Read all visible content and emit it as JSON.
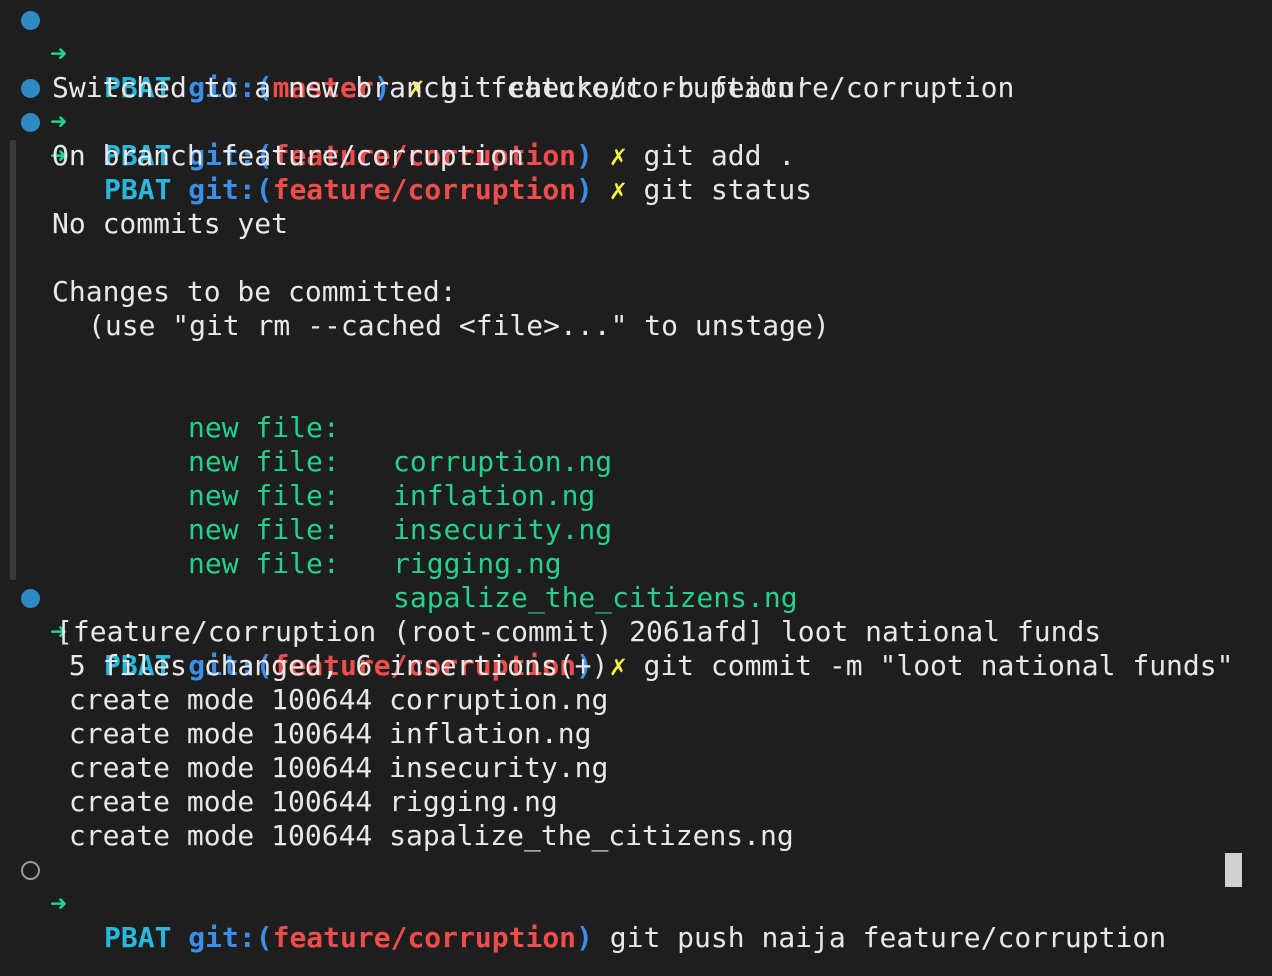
{
  "prompts": [
    {
      "dir": "PBAT",
      "git_prefix": "git:(",
      "branch": "master",
      "git_suffix": ")",
      "dirty": "✗",
      "command": "git checkout -b feature/corruption"
    },
    {
      "dir": "PBAT",
      "git_prefix": "git:(",
      "branch": "feature/corruption",
      "git_suffix": ")",
      "dirty": "✗",
      "command": "git add ."
    },
    {
      "dir": "PBAT",
      "git_prefix": "git:(",
      "branch": "feature/corruption",
      "git_suffix": ")",
      "dirty": "✗",
      "command": "git status"
    },
    {
      "dir": "PBAT",
      "git_prefix": "git:(",
      "branch": "feature/corruption",
      "git_suffix": ")",
      "dirty": "✗",
      "command": "git commit -m \"loot national funds\""
    },
    {
      "dir": "PBAT",
      "git_prefix": "git:(",
      "branch": "feature/corruption",
      "git_suffix": ")",
      "dirty": "",
      "command": "git push naija feature/corruption"
    }
  ],
  "arrow": "➜",
  "checkout_output": "Switched to a new branch 'feature/corruption'",
  "status_output": {
    "on_branch": "On branch feature/corruption",
    "no_commits": "No commits yet",
    "changes_header": "Changes to be committed:",
    "hint": "(use \"git rm --cached <file>...\" to unstage)",
    "new_file_label": "new file:",
    "files": [
      "corruption.ng",
      "inflation.ng",
      "insecurity.ng",
      "rigging.ng",
      "sapalize_the_citizens.ng"
    ]
  },
  "commit_output": {
    "summary": "[feature/corruption (root-commit) 2061afd] loot national funds",
    "stats": " 5 files changed, 6 insertions(+)",
    "create_lines": [
      " create mode 100644 corruption.ng",
      " create mode 100644 inflation.ng",
      " create mode 100644 insecurity.ng",
      " create mode 100644 rigging.ng",
      " create mode 100644 sapalize_the_citizens.ng"
    ]
  },
  "colors": {
    "background": "#1e1e1e",
    "dir": "#29b8db",
    "git": "#3b8eea",
    "branch": "#f14c4c",
    "dirty": "#f5f543",
    "arrow": "#23d18b",
    "new_file": "#23d18b"
  }
}
